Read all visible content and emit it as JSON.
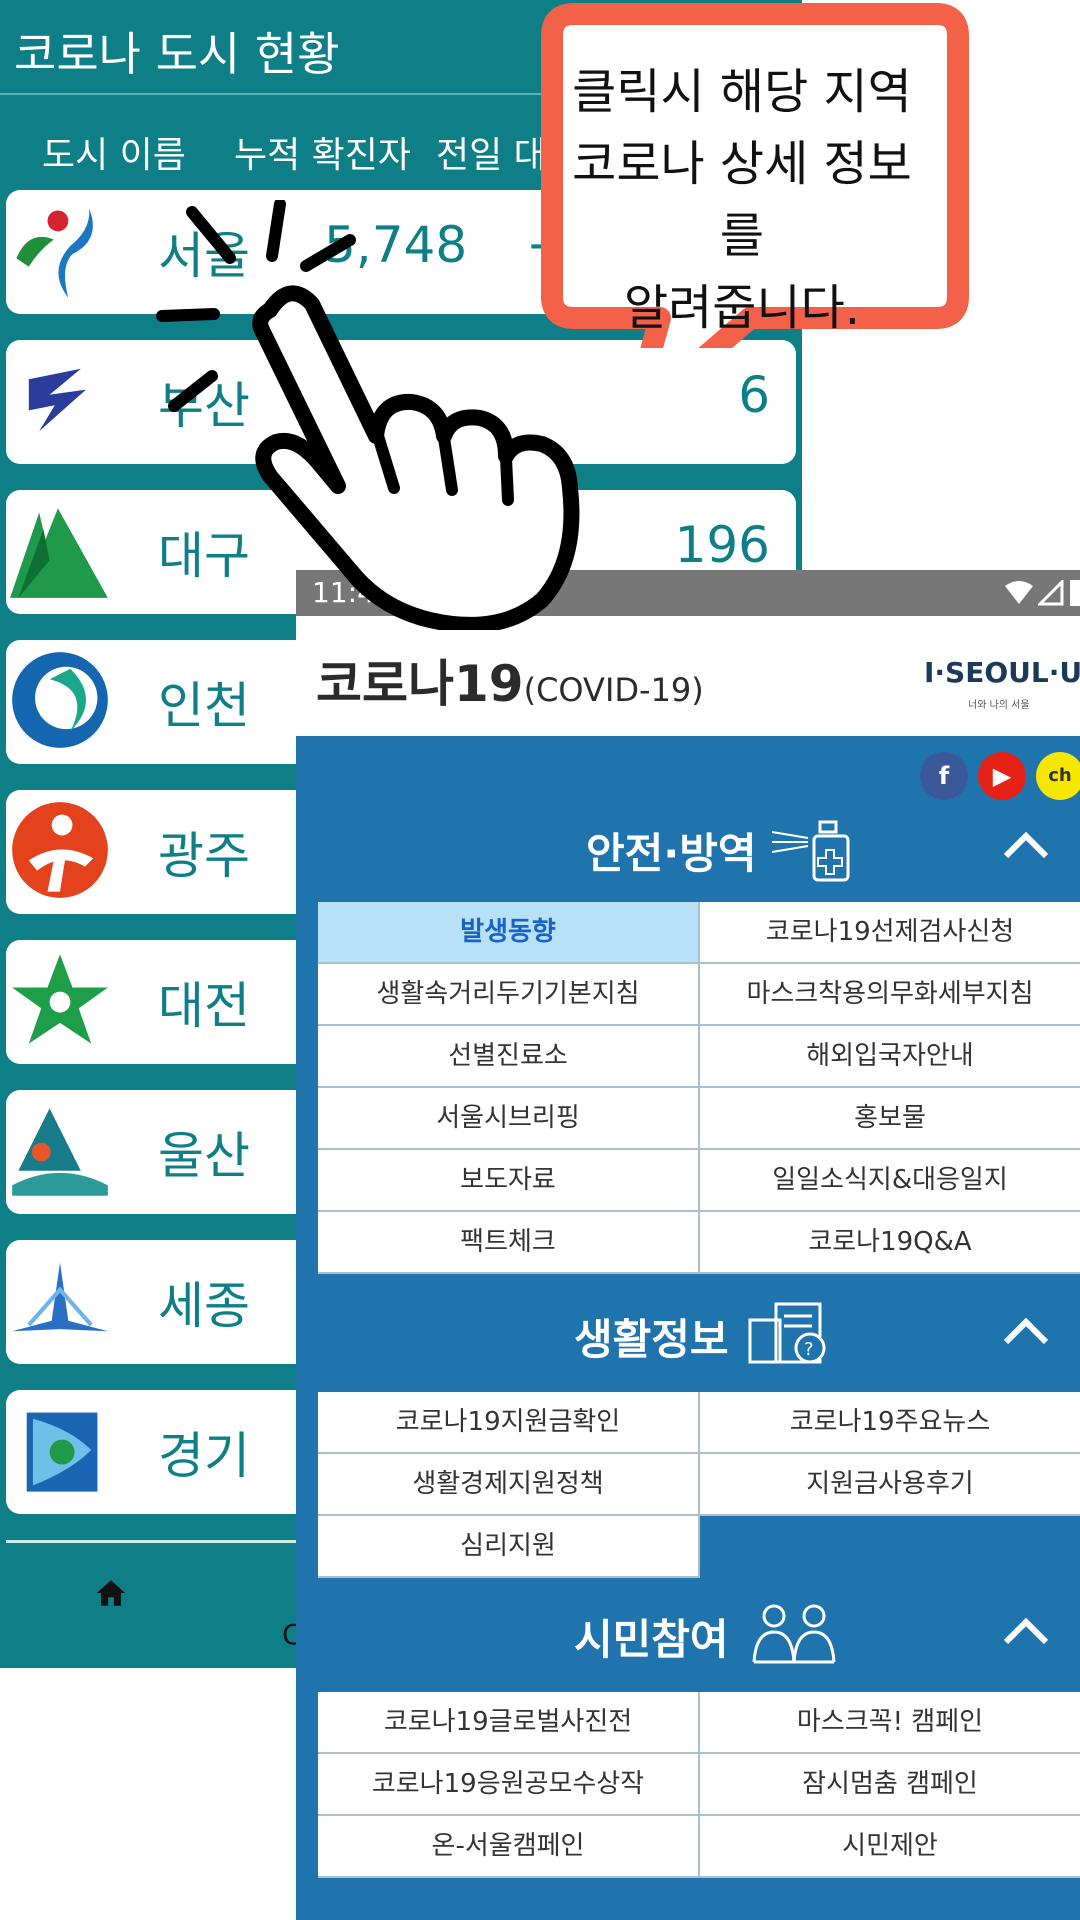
{
  "city_app": {
    "title": "코로나 도시 현황",
    "columns": [
      "도시 이름",
      "누적 확진자",
      "전일 대비"
    ],
    "cities": [
      {
        "name": "서울",
        "total": "5,748",
        "plus": "+",
        "daily": ""
      },
      {
        "name": "부산",
        "total": "",
        "plus": "",
        "daily": "6"
      },
      {
        "name": "대구",
        "total": "",
        "plus": "",
        "daily": "196"
      },
      {
        "name": "인천",
        "total": "",
        "plus": "",
        "daily": ""
      },
      {
        "name": "광주",
        "total": "",
        "plus": "",
        "daily": ""
      },
      {
        "name": "대전",
        "total": "",
        "plus": "",
        "daily": ""
      },
      {
        "name": "울산",
        "total": "",
        "plus": "",
        "daily": ""
      },
      {
        "name": "세종",
        "total": "",
        "plus": "",
        "daily": ""
      },
      {
        "name": "경기",
        "total": "",
        "plus": "",
        "daily": ""
      }
    ],
    "nav": {
      "home_icon": "home-icon",
      "partial_label": "C"
    },
    "colors": {
      "teal": "#0e7e87"
    }
  },
  "tooltip": {
    "lines": [
      "클릭시 해당 지역",
      "코로나 상세 정보를",
      "알려줍니다."
    ],
    "border_color": "#f26148"
  },
  "seoul_page": {
    "status_time": "11:45",
    "brand_title": "코로나19",
    "brand_sub": "(COVID-19)",
    "seoul_logo": "I·SEOUL·U",
    "seoul_logo_sub": "너와 나의 서울",
    "social": [
      {
        "icon": "facebook-icon",
        "glyph": "f",
        "color": "#3b5998"
      },
      {
        "icon": "youtube-icon",
        "glyph": "▶",
        "color": "#e62117"
      },
      {
        "icon": "kakao-channel-icon",
        "glyph": "ch",
        "color": "#f7e600"
      }
    ],
    "sections": [
      {
        "title": "안전·방역",
        "icon": "sanitizer-spray-icon",
        "items": [
          "발생동향",
          "코로나19선제검사신청",
          "생활속거리두기기본지침",
          "마스크착용의무화세부지침",
          "선별진료소",
          "해외입국자안내",
          "서울시브리핑",
          "홍보물",
          "보도자료",
          "일일소식지&대응일지",
          "팩트체크",
          "코로나19Q&A"
        ]
      },
      {
        "title": "생활정보",
        "icon": "info-document-icon",
        "items": [
          "코로나19지원금확인",
          "코로나19주요뉴스",
          "생활경제지원정책",
          "지원금사용후기",
          "심리지원"
        ]
      },
      {
        "title": "시민참여",
        "icon": "people-icon",
        "items": [
          "코로나19글로벌사진전",
          "마스크꼭! 캠페인",
          "코로나19응원공모수상작",
          "잠시멈춤 캠페인",
          "온-서울캠페인",
          "시민제안"
        ]
      }
    ],
    "colors": {
      "panel_blue": "#1f74ae",
      "active_cell": "#b8e0f7"
    }
  },
  "overlay": {
    "hand_icon": "pointing-hand-icon"
  }
}
